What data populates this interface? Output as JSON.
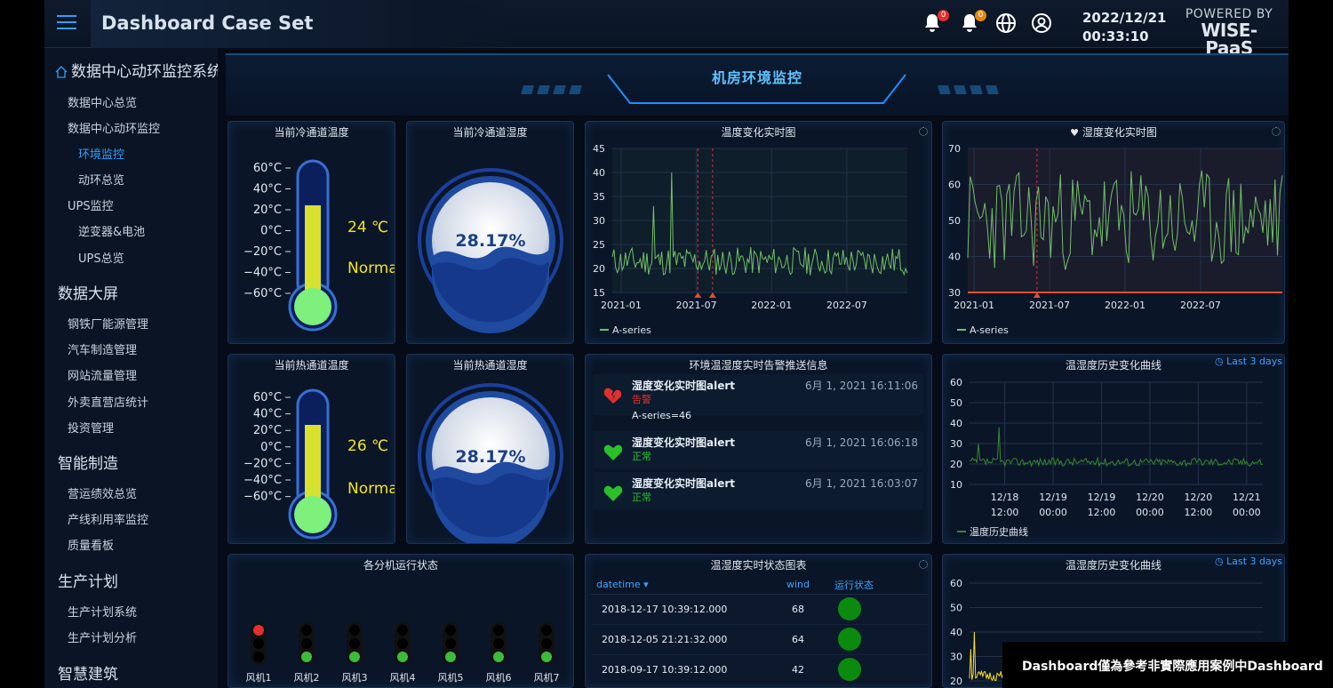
{
  "header": {
    "title": "Dashboard Case Set",
    "badge_1": "0",
    "badge_2": "0",
    "date": "2022/12/21",
    "time": "00:33:10",
    "powered_line1": "POWERED BY",
    "powered_line2": "WISE-PaaS"
  },
  "sidebar": {
    "root": "数据中心动环监控系统",
    "items": [
      {
        "label": "数据中心总览"
      },
      {
        "label": "数据中心动环监控"
      },
      {
        "label": "环境监控"
      },
      {
        "label": "动环总览"
      },
      {
        "label": "UPS监控"
      },
      {
        "label": "逆变器&电池"
      },
      {
        "label": "UPS总览"
      },
      {
        "label": "数据大屏"
      },
      {
        "label": "钢铁厂能源管理"
      },
      {
        "label": "汽车制造管理"
      },
      {
        "label": "网站流量管理"
      },
      {
        "label": "外卖直营店统计"
      },
      {
        "label": "投资管理"
      },
      {
        "label": "智能制造"
      },
      {
        "label": "营运绩效总览"
      },
      {
        "label": "产线利用率监控"
      },
      {
        "label": "质量看板"
      },
      {
        "label": "生产计划"
      },
      {
        "label": "生产计划系统"
      },
      {
        "label": "生产计划分析"
      },
      {
        "label": "智慧建筑"
      }
    ]
  },
  "banner": {
    "title": "机房环境监控"
  },
  "panels": {
    "cold_temp": {
      "title": "当前冷通道温度",
      "value": "24 ℃",
      "status": "Normal",
      "ticks": [
        "60°C",
        "40°C",
        "20°C",
        "0°C",
        "−20°C",
        "−40°C",
        "−60°C"
      ]
    },
    "cold_hum": {
      "title": "当前冷通道湿度",
      "value": "28.17%"
    },
    "hot_temp": {
      "title": "当前热通道温度",
      "value": "26 ℃",
      "status": "Normal",
      "ticks": [
        "60°C",
        "40°C",
        "20°C",
        "0°C",
        "−20°C",
        "−40°C",
        "−60°C"
      ]
    },
    "hot_hum": {
      "title": "当前热通道湿度",
      "value": "28.17%"
    },
    "temp_rt": {
      "title": "温度变化实时图",
      "legend": "A-series"
    },
    "hum_rt": {
      "title": "湿度变化实时图",
      "legend": "A-series"
    },
    "alerts": {
      "title": "环境温湿度实时告警推送信息",
      "items": [
        {
          "name": "湿度变化实时图alert",
          "state": "告警",
          "extra": "A-series=46",
          "time": "6月 1, 2021 16:11:06"
        },
        {
          "name": "湿度变化实时图alert",
          "state": "正常",
          "extra": "",
          "time": "6月 1, 2021 16:06:18"
        },
        {
          "name": "湿度变化实时图alert",
          "state": "正常",
          "extra": "",
          "time": "6月 1, 2021 16:03:07"
        }
      ]
    },
    "hist1": {
      "title": "温湿度历史变化曲线",
      "range": "Last 3 days",
      "legend": "温度历史曲线"
    },
    "fans": {
      "title": "各分机运行状态",
      "labels": [
        "风机1",
        "风机2",
        "风机3",
        "风机4",
        "风机5",
        "风机6",
        "风机7"
      ],
      "states": [
        "red",
        "green",
        "green",
        "green",
        "green",
        "green",
        "green"
      ]
    },
    "status_tbl": {
      "title": "温湿度实时状态图表",
      "columns": [
        "datetime",
        "wind",
        "运行状态"
      ],
      "rows": [
        {
          "datetime": "2018-12-17 10:39:12.000",
          "wind": "68"
        },
        {
          "datetime": "2018-12-05 21:21:32.000",
          "wind": "64"
        },
        {
          "datetime": "2018-09-17 10:39:12.000",
          "wind": "42"
        }
      ]
    },
    "hist2": {
      "title": "温湿度历史变化曲线",
      "range": "Last 3 days"
    }
  },
  "caption": "Dashboard僅為參考非實際應用案例中Dashboard",
  "chart_data": [
    {
      "type": "line",
      "title": "温度变化实时图",
      "x_ticks": [
        "2021-01",
        "2021-07",
        "2022-01",
        "2022-07"
      ],
      "ylim": [
        15,
        45
      ],
      "y_ticks": [
        15,
        20,
        25,
        30,
        35,
        40,
        45
      ],
      "series": [
        {
          "name": "A-series",
          "baseline": 21.5,
          "noise": 3,
          "spikes": [
            {
              "x": 0.14,
              "y": 33
            },
            {
              "x": 0.2,
              "y": 40
            }
          ],
          "color": "#73bf69"
        }
      ],
      "annotations_x": [
        0.29,
        0.34
      ]
    },
    {
      "type": "line",
      "title": "湿度变化实时图",
      "x_ticks": [
        "2021-01",
        "2021-07",
        "2022-01",
        "2022-07"
      ],
      "ylim": [
        30,
        70
      ],
      "y_ticks": [
        30,
        40,
        50,
        60,
        70
      ],
      "series": [
        {
          "name": "A-series",
          "baseline": 50,
          "noise": 14,
          "color": "#73bf69"
        }
      ],
      "annotations_x": [
        0.22
      ],
      "threshold": 30
    },
    {
      "type": "line",
      "title": "温湿度历史变化曲线",
      "x_ticks": [
        "12/18\n12:00",
        "12/19\n00:00",
        "12/19\n12:00",
        "12/20\n00:00",
        "12/20\n12:00",
        "12/21\n00:00"
      ],
      "ylim": [
        10,
        60
      ],
      "y_ticks": [
        10,
        20,
        30,
        40,
        50,
        60
      ],
      "series": [
        {
          "name": "温度历史曲线",
          "baseline": 21,
          "noise": 2,
          "spikes": [
            {
              "x": 0.03,
              "y": 30
            },
            {
              "x": 0.1,
              "y": 38
            }
          ],
          "color": "#37872d"
        }
      ]
    },
    {
      "type": "line",
      "title": "温湿度历史变化曲线",
      "ylim": [
        20,
        60
      ],
      "y_ticks": [
        20,
        30,
        40,
        50,
        60
      ],
      "series": [
        {
          "name": "",
          "baseline": 22,
          "noise": 2,
          "spikes": [
            {
              "x": 0.03,
              "y": 33
            },
            {
              "x": 0.1,
              "y": 40
            }
          ],
          "color": "#fade2a"
        }
      ]
    }
  ]
}
